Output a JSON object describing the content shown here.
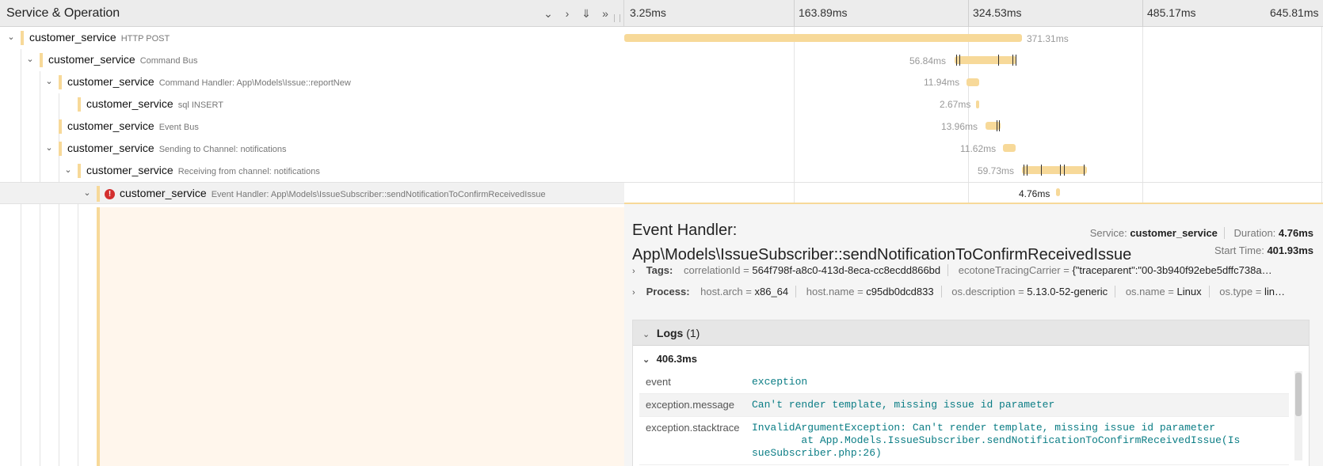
{
  "header": {
    "title": "Service & Operation",
    "ticks": [
      "3.25ms",
      "163.89ms",
      "324.53ms",
      "485.17ms",
      "645.81ms"
    ]
  },
  "spans": [
    {
      "service": "customer_service",
      "operation": "HTTP POST",
      "duration": "371.31ms"
    },
    {
      "service": "customer_service",
      "operation": "Command Bus",
      "duration": "56.84ms"
    },
    {
      "service": "customer_service",
      "operation": "Command Handler: App\\Models\\Issue::reportNew",
      "duration": "11.94ms"
    },
    {
      "service": "customer_service",
      "operation": "sql INSERT",
      "duration": "2.67ms"
    },
    {
      "service": "customer_service",
      "operation": "Event Bus",
      "duration": "13.96ms"
    },
    {
      "service": "customer_service",
      "operation": "Sending to Channel: notifications",
      "duration": "11.62ms"
    },
    {
      "service": "customer_service",
      "operation": "Receiving from channel: notifications",
      "duration": "59.73ms"
    },
    {
      "service": "customer_service",
      "operation": "Event Handler: App\\Models\\IssueSubscriber::sendNotificationToConfirmReceivedIssue",
      "duration": "4.76ms",
      "error_icon": "!"
    }
  ],
  "detail": {
    "title": "Event Handler: App\\Models\\IssueSubscriber::sendNotificationToConfirmReceivedIssue",
    "service_label": "Service:",
    "service": "customer_service",
    "duration_label": "Duration:",
    "duration": "4.76ms",
    "start_label": "Start Time:",
    "start": "401.93ms",
    "tags_label": "Tags:",
    "tags": [
      {
        "k": "correlationId",
        "v": "564f798f-a8c0-413d-8eca-cc8ecdd866bd"
      },
      {
        "k": "ecotoneTracingCarrier",
        "v": "{\"traceparent\":\"00-3b940f92ebe5dffc738a…"
      }
    ],
    "process_label": "Process:",
    "process": [
      {
        "k": "host.arch",
        "v": "x86_64"
      },
      {
        "k": "host.name",
        "v": "c95db0dcd833"
      },
      {
        "k": "os.description",
        "v": "5.13.0-52-generic"
      },
      {
        "k": "os.name",
        "v": "Linux"
      },
      {
        "k": "os.type",
        "v": "lin…"
      }
    ],
    "logs_label": "Logs",
    "logs_count": "(1)",
    "log_time": "406.3ms",
    "log_fields": [
      {
        "k": "event",
        "v": "exception"
      },
      {
        "k": "exception.message",
        "v": "Can't render template, missing issue id parameter"
      },
      {
        "k": "exception.stacktrace",
        "v": "InvalidArgumentException: Can't render template, missing issue id parameter\n        at App.Models.IssueSubscriber.sendNotificationToConfirmReceivedIssue(Is\nsueSubscriber.php:26)"
      }
    ]
  },
  "icons": {
    "collapse_one": "chevron-down-icon",
    "expand_one": "chevron-right-icon",
    "collapse_all": "double-chevron-down-icon",
    "expand_all": "double-chevron-right-icon"
  },
  "colors": {
    "span_bar": "#f7d999",
    "detail_bg": "#fff6ec",
    "error": "#d32f2f",
    "log_value": "#0b7d85"
  }
}
